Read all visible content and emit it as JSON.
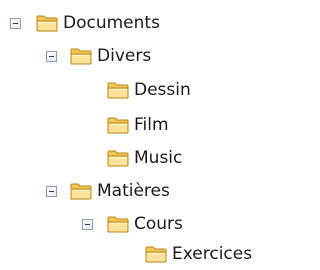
{
  "tree": {
    "nodes": [
      {
        "id": "documents",
        "label": "Documents",
        "expanded": true,
        "icon": "folder-icon"
      },
      {
        "id": "divers",
        "label": "Divers",
        "expanded": true,
        "icon": "folder-icon"
      },
      {
        "id": "dessin",
        "label": "Dessin",
        "icon": "folder-icon"
      },
      {
        "id": "film",
        "label": "Film",
        "icon": "folder-icon"
      },
      {
        "id": "music",
        "label": "Music",
        "icon": "folder-icon"
      },
      {
        "id": "matieres",
        "label": "Matières",
        "expanded": true,
        "icon": "folder-icon"
      },
      {
        "id": "cours",
        "label": "Cours",
        "expanded": true,
        "icon": "folder-icon"
      },
      {
        "id": "exercices",
        "label": "Exercices",
        "icon": "folder-icon"
      }
    ]
  },
  "colors": {
    "folder_fill": "#f5d27a",
    "folder_dark": "#d9a235",
    "toggle_border": "#8c9cb4"
  }
}
